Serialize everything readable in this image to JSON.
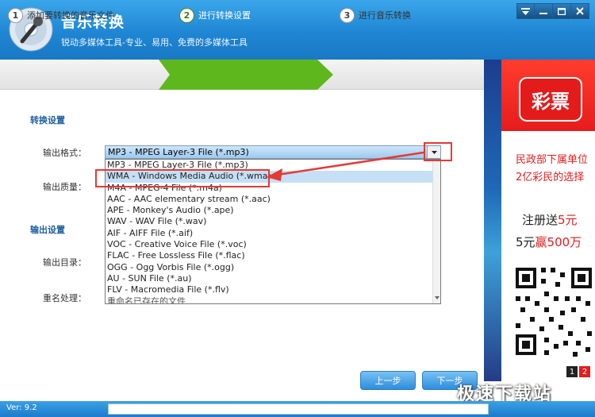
{
  "window": {
    "title": "音乐转换",
    "subtitle": "锐动多媒体工具-专业、易用、免费的多媒体工具"
  },
  "steps": [
    {
      "num": "1",
      "label": "添加要转换的音乐文件"
    },
    {
      "num": "2",
      "label": "进行转换设置"
    },
    {
      "num": "3",
      "label": "进行音乐转换"
    }
  ],
  "settings": {
    "convert_title": "转换设置",
    "output_format_label": "输出格式：",
    "output_quality_label": "输出质量：",
    "output_settings_title": "输出设置",
    "output_dir_label": "输出目录：",
    "rename_label": "重名处理："
  },
  "format_select": {
    "value": "MP3 - MPEG Layer-3 File (*.mp3)",
    "options": [
      "MP3 - MPEG Layer-3 File (*.mp3)",
      "WMA - Windows Media Audio (*.wma)",
      "M4A - MPEG-4 File (*.m4a)",
      "AAC - AAC elementary stream (*.aac)",
      "APE - Monkey's Audio (*.ape)",
      "WAV - WAV File (*.wav)",
      "AIF - AIFF File (*.aif)",
      "VOC - Creative Voice File (*.voc)",
      "FLAC - Free Lossless File (*.flac)",
      "OGG - Ogg Vorbis File (*.ogg)",
      "AU - SUN File (*.au)",
      "FLV - Macromedia File (*.flv)"
    ],
    "highlighted_index": 1,
    "behind_text": "重命名已存在的文件"
  },
  "buttons": {
    "prev": "上一步",
    "next": "下一步"
  },
  "ad": {
    "badge": "彩票",
    "line1": "民政部下属单位",
    "line2": "2亿彩民的选择",
    "line3_a": "注册送",
    "line3_b": "5元",
    "line4_a": "5元",
    "line4_b": "赢500万",
    "page1": "1",
    "page2": "2"
  },
  "status": {
    "version": "Ver: 9.2"
  },
  "watermark": "极速下载站",
  "colors": {
    "title_bar": "#1f86d3",
    "active_step": "#5fb71e",
    "highlight_box": "#e53935",
    "section_title": "#1f5fa0"
  }
}
